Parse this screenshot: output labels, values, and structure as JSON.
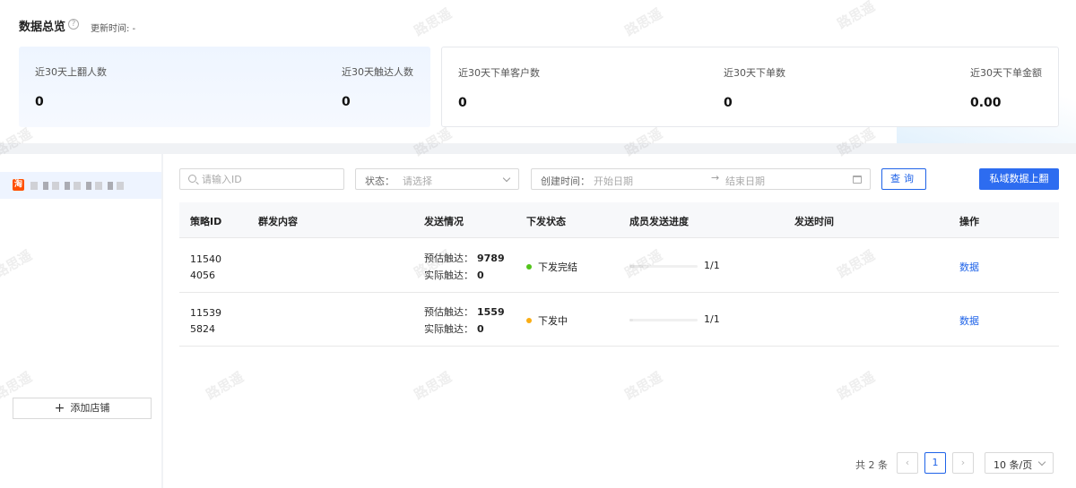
{
  "overview": {
    "title": "数据总览",
    "help_glyph": "?",
    "update_time": "更新时间: -",
    "left_stats": [
      {
        "label": "近30天上翻人数",
        "value": "0"
      },
      {
        "label": "近30天触达人数",
        "value": "0"
      }
    ],
    "right_stats": [
      {
        "label": "近30天下单客户数",
        "value": "0"
      },
      {
        "label": "近30天下单数",
        "value": "0"
      },
      {
        "label": "近30天下单金额",
        "value": "0.00"
      }
    ]
  },
  "sidebar": {
    "shop_logo_glyph": "淘",
    "add_shop_plus": "+",
    "add_shop_label": "添加店铺"
  },
  "filters": {
    "id_placeholder": "请输入ID",
    "status_label": "状态：",
    "status_placeholder": "请选择",
    "created_label": "创建时间：",
    "start_placeholder": "开始日期",
    "range_arrow": "→",
    "end_placeholder": "结束日期",
    "query_label": "查询",
    "sync_label": "私域数据上翻"
  },
  "table": {
    "headers": [
      "策略ID",
      "群发内容",
      "发送情况",
      "下发状态",
      "成员发送进度",
      "发送时间",
      "操作"
    ],
    "rows": [
      {
        "id": "115404056",
        "est_label": "预估触达：",
        "est_value": "9789",
        "actual_label": "实际触达：",
        "actual_value": "0",
        "status": "下发完结",
        "progress": 0.2,
        "progress_text": "1/1",
        "action": "数据"
      },
      {
        "id": "115395824",
        "est_label": "预估触达：",
        "est_value": "1559",
        "actual_label": "实际触达：",
        "actual_value": "0",
        "status": "下发中",
        "progress": 0.05,
        "progress_text": "1/1",
        "action": "数据"
      }
    ]
  },
  "pagination": {
    "total_text": "共 2 条",
    "prev_glyph": "‹",
    "current_page": "1",
    "next_glyph": "›",
    "page_size": "10 条/页"
  },
  "colors": {
    "accent": "#1f63e8",
    "status_done": "#52c41a",
    "status_running": "#faad14"
  },
  "watermark_text": "路思遥"
}
